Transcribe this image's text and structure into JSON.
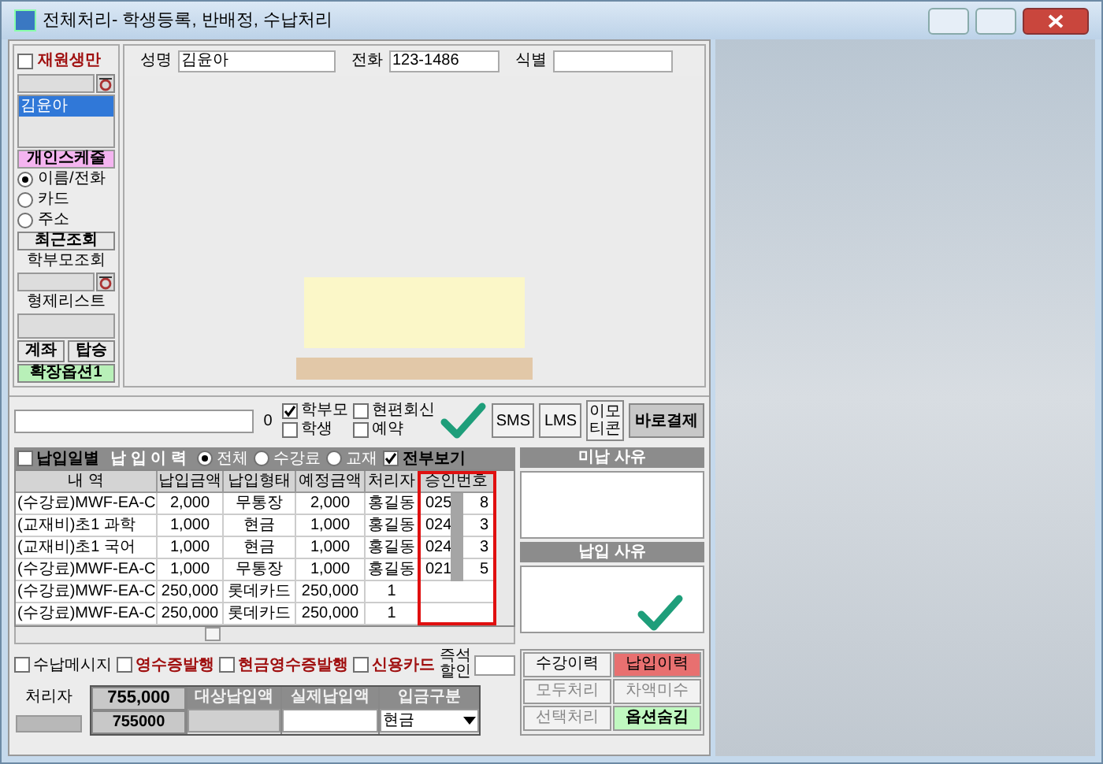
{
  "window": {
    "title": "전체처리- 학생등록, 반배정, 수납처리"
  },
  "sidebar": {
    "enrolled_only": {
      "label": "재원생만",
      "checked": false
    },
    "students": [
      {
        "name": "김윤아",
        "selected": true
      }
    ],
    "schedule_button": "개인스케줄",
    "search_modes": [
      {
        "label": "이름/전화",
        "selected": true
      },
      {
        "label": "카드",
        "selected": false
      },
      {
        "label": "주소",
        "selected": false
      }
    ],
    "recent_button": "최근조회",
    "parent_label": "학부모조회",
    "sibling_label": "형제리스트",
    "buttons": [
      "계좌",
      "탑승"
    ],
    "extend_button": "확장옵션1"
  },
  "student_fields": [
    {
      "label": "성명",
      "value": "김윤아"
    },
    {
      "label": "전화",
      "value": "123-1486"
    },
    {
      "label": "식별"
    }
  ],
  "message_bar": {
    "count": "0",
    "targets": [
      {
        "label": "학부모",
        "checked": true
      },
      {
        "label": "현편회신",
        "checked": false
      },
      {
        "label": "학생",
        "checked": false
      },
      {
        "label": "예약",
        "checked": false
      }
    ],
    "buttons": [
      "SMS",
      "LMS",
      "이모티콘",
      "바로결제"
    ]
  },
  "history": {
    "by_date": {
      "label": "납입일별",
      "checked": false
    },
    "title": "납 입 이 력",
    "filters": [
      {
        "label": "전체",
        "selected": true
      },
      {
        "label": "수강료",
        "selected": false
      },
      {
        "label": "교재",
        "selected": false
      }
    ],
    "show_all": {
      "label": "전부보기",
      "checked": true
    },
    "columns": [
      "내 역",
      "납입금액",
      "납입형태",
      "예정금액",
      "처리자",
      "승인번호"
    ],
    "rows": [
      {
        "item": "(수강료)MWF-EA-C",
        "paid": "2,000",
        "method": "무통장",
        "planned": "2,000",
        "handler": "홍길동",
        "approval_head": "025",
        "approval_tail": "8"
      },
      {
        "item": "(교재비)초1 과학",
        "paid": "1,000",
        "method": "현금",
        "planned": "1,000",
        "handler": "홍길동",
        "approval_head": "024",
        "approval_tail": "3"
      },
      {
        "item": "(교재비)초1 국어",
        "paid": "1,000",
        "method": "현금",
        "planned": "1,000",
        "handler": "홍길동",
        "approval_head": "024",
        "approval_tail": "3"
      },
      {
        "item": "(수강료)MWF-EA-C",
        "paid": "1,000",
        "method": "무통장",
        "planned": "1,000",
        "handler": "홍길동",
        "approval_head": "021",
        "approval_tail": "5"
      },
      {
        "item": "(수강료)MWF-EA-C",
        "paid": "250,000",
        "method": "롯데카드",
        "planned": "250,000",
        "handler": "1"
      },
      {
        "item": "(수강료)MWF-EA-C",
        "paid": "250,000",
        "method": "롯데카드",
        "planned": "250,000",
        "handler": "1"
      }
    ]
  },
  "reasons": [
    "미납 사유",
    "납입 사유"
  ],
  "options": [
    {
      "label": "수납메시지",
      "checked": false,
      "kind": "plain"
    },
    {
      "label": "영수증발행",
      "checked": false,
      "kind": "alert"
    },
    {
      "label": "현금영수증발행",
      "checked": false,
      "kind": "alert"
    },
    {
      "label": "신용카드",
      "checked": false,
      "kind": "alert"
    }
  ],
  "discount_label": "즉석할인",
  "payment": {
    "handler_label": "처리자",
    "total": "755,000",
    "total_raw": "755000",
    "columns": [
      "대상납입액",
      "실제납입액",
      "입금구분"
    ],
    "deposit_type": "현금"
  },
  "actions": [
    {
      "label": "수강이력",
      "kind": "normal"
    },
    {
      "label": "납입이력",
      "kind": "active"
    },
    {
      "label": "모두처리",
      "kind": "muted"
    },
    {
      "label": "차액미수",
      "kind": "muted"
    },
    {
      "label": "선택처리",
      "kind": "muted"
    },
    {
      "label": "옵션숨김",
      "kind": "green"
    }
  ]
}
